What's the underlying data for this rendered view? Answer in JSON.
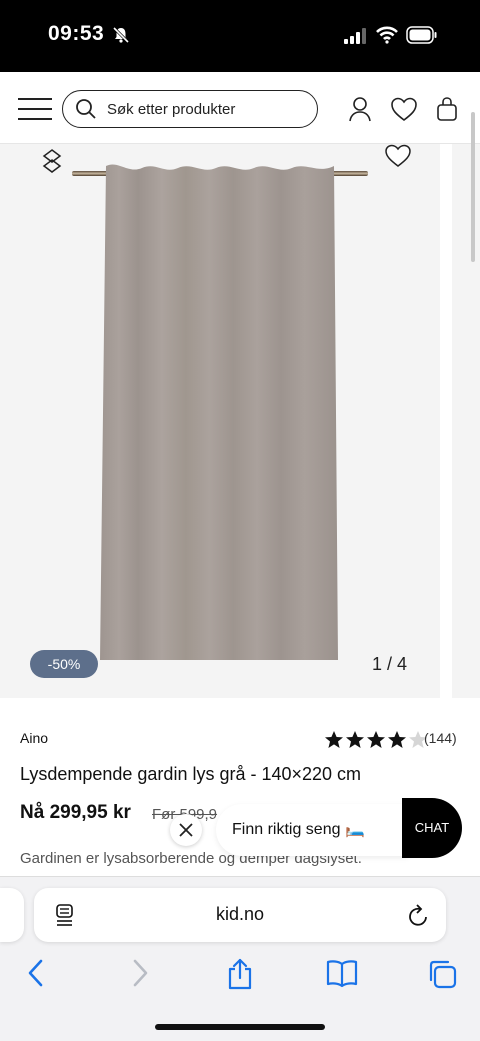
{
  "status_bar": {
    "time": "09:53"
  },
  "header": {
    "search_placeholder": "Søk etter produkter"
  },
  "gallery": {
    "discount_badge": "-50%",
    "image_counter": "1 / 4"
  },
  "product": {
    "brand": "Aino",
    "rating": 4,
    "rating_max": 5,
    "review_count": "(144)",
    "title": "Lysdempende gardin lys grå - 140×220 cm",
    "price_now": "Nå 299,95 kr",
    "price_before": "Før 599,9",
    "description": "Gardinen er lysabsorberende og demper dagslyset."
  },
  "popup": {
    "text": "Finn riktig seng 🛏️",
    "chat_label": "CHAT"
  },
  "browser": {
    "url": "kid.no"
  },
  "colors": {
    "badge": "#5d6f8b",
    "curtain": "#a59c98",
    "chat": "#000000"
  }
}
